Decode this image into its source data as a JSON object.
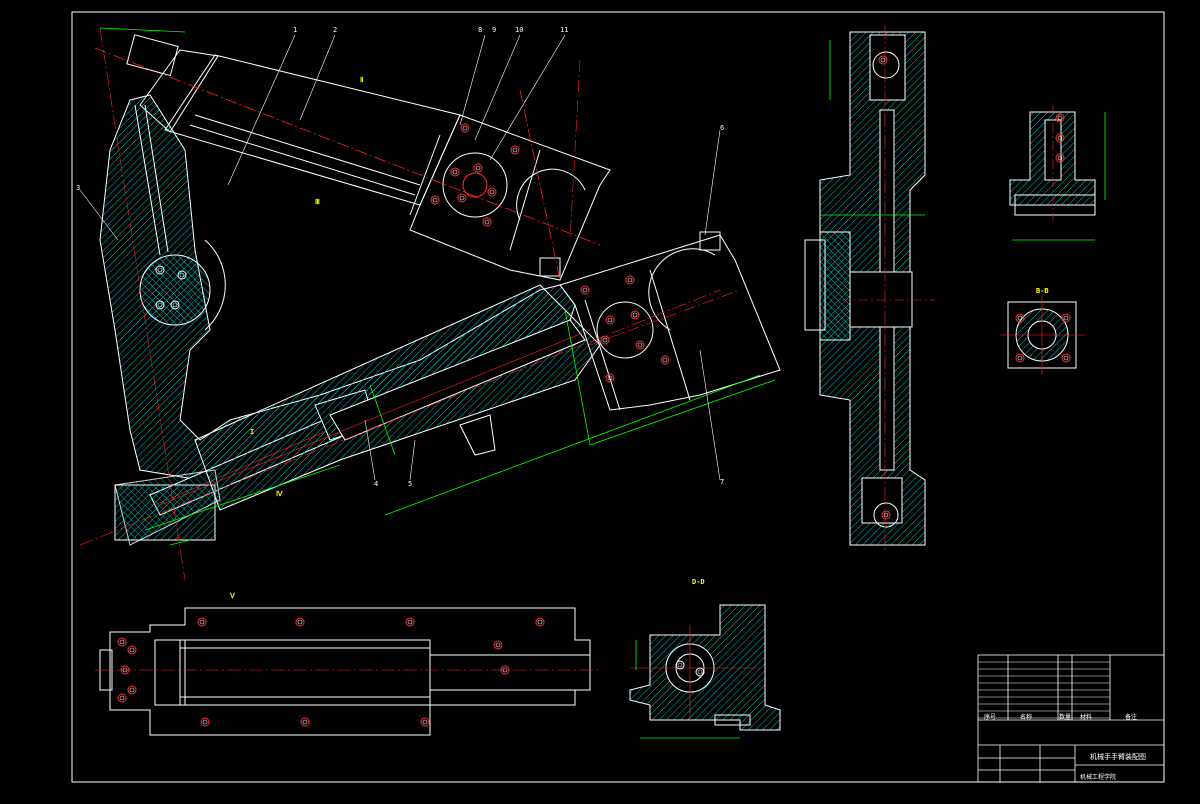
{
  "colors": {
    "background": "#000000",
    "outline": "#ffffff",
    "hatch": "#00c0c0",
    "centerline": "#ff2020",
    "dimension": "#00ff00",
    "hole": "#ff3030",
    "label": "#ffff00"
  },
  "drawing": {
    "section_labels": [
      "I",
      "Ⅱ",
      "Ⅲ",
      "Ⅳ",
      "Ⅴ"
    ],
    "view_labels": [
      "D-D",
      "B-B"
    ],
    "balloons": [
      "1",
      "2",
      "3",
      "4",
      "5",
      "6",
      "7",
      "8",
      "9",
      "10",
      "11"
    ]
  },
  "title_block": {
    "header": {
      "seq": "序号",
      "name": "名称",
      "qty": "数量",
      "material": "材料",
      "note": "备注"
    },
    "drawing_title": "机械手手臂装配图",
    "school": "机械工程学院"
  }
}
